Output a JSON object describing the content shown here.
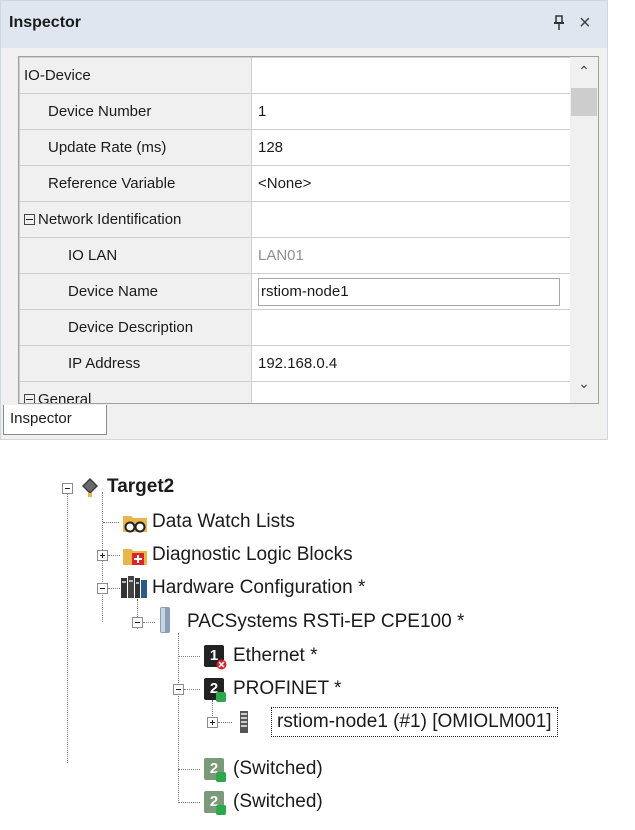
{
  "inspector": {
    "title": "Inspector",
    "rows": [
      {
        "name": "IO-Device",
        "value": "",
        "indent": 0
      },
      {
        "name": "Device Number",
        "value": "1",
        "indent": 1
      },
      {
        "name": "Update Rate (ms)",
        "value": "128",
        "indent": 1
      },
      {
        "name": "Reference Variable",
        "value": "<None>",
        "indent": 1
      },
      {
        "name": "Network Identification",
        "value": "",
        "indent": 0,
        "expander": true
      },
      {
        "name": "IO LAN",
        "value": "LAN01",
        "indent": 2,
        "readonly": true
      },
      {
        "name": "Device Name",
        "value": "rstiom-node1",
        "indent": 2,
        "editing": true
      },
      {
        "name": "Device Description",
        "value": "",
        "indent": 2
      },
      {
        "name": "IP Address",
        "value": "192.168.0.4",
        "indent": 2
      },
      {
        "name": "General",
        "value": "",
        "indent": 0,
        "expander": true
      }
    ],
    "tab_label": "Inspector",
    "icons": {
      "pin": "pin-icon",
      "close": "close-icon",
      "scroll_up": "chevron-up-icon",
      "scroll_down": "chevron-down-icon"
    }
  },
  "tree": {
    "target": "Target2",
    "data_watch": "Data Watch Lists",
    "diagnostic": "Diagnostic Logic Blocks",
    "hardware": "Hardware Configuration *",
    "cpu": "PACSystems RSTi-EP CPE100 *",
    "ethernet": "Ethernet *",
    "profinet": "PROFINET *",
    "node": "rstiom-node1 (#1) [OMIOLM001]",
    "switched1": "(Switched)",
    "switched2": "(Switched)",
    "badges": {
      "ethernet": "1",
      "profinet": "2",
      "switched": "2"
    },
    "colors": {
      "folder": "#e8b64a",
      "red": "#d6262b",
      "green": "#2aa84a",
      "dark": "#222222"
    }
  }
}
